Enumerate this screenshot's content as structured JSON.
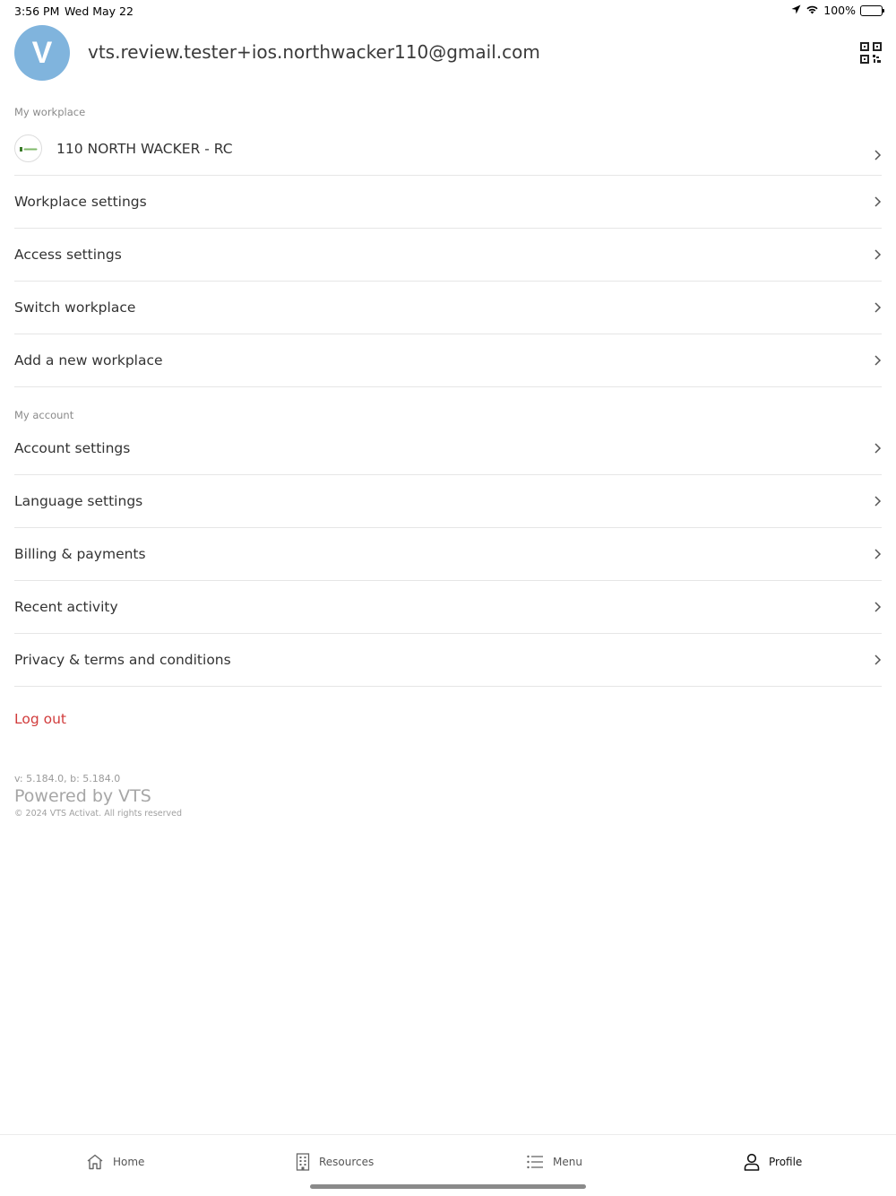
{
  "status_bar": {
    "time": "3:56 PM",
    "date": "Wed May 22",
    "battery": "100%"
  },
  "user": {
    "avatar_initial": "V",
    "email": "vts.review.tester+ios.northwacker110@gmail.com",
    "avatar_color": "#80b4dd"
  },
  "my_workplace": {
    "section_label": "My workplace",
    "current_workplace": "110 NORTH WACKER - RC",
    "items": [
      {
        "label": "Workplace settings"
      },
      {
        "label": "Access settings"
      },
      {
        "label": "Switch workplace"
      },
      {
        "label": "Add a new workplace"
      }
    ]
  },
  "my_account": {
    "section_label": "My account",
    "items": [
      {
        "label": "Account settings"
      },
      {
        "label": "Language settings"
      },
      {
        "label": "Billing & payments"
      },
      {
        "label": "Recent activity"
      },
      {
        "label": "Privacy & terms and conditions"
      }
    ]
  },
  "logout_label": "Log out",
  "logout_color": "#d13b3b",
  "footer": {
    "version": "v: 5.184.0, b: 5.184.0",
    "powered_by": "Powered by VTS",
    "copyright": "© 2024 VTS Activat. All rights reserved"
  },
  "tab_bar": {
    "tabs": [
      {
        "label": "Home",
        "icon": "home-icon"
      },
      {
        "label": "Resources",
        "icon": "building-icon"
      },
      {
        "label": "Menu",
        "icon": "list-icon"
      },
      {
        "label": "Profile",
        "icon": "person-icon"
      }
    ],
    "active": "Profile"
  }
}
